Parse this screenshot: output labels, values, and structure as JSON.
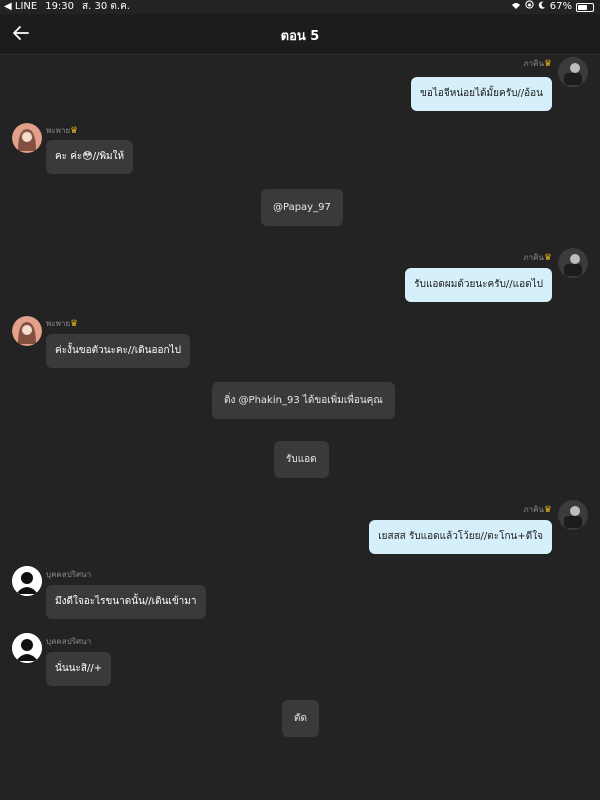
{
  "status_bar": {
    "carrier": "◀ LINE",
    "time": "19:30",
    "date": "ส. 30 ต.ค.",
    "battery": "67%"
  },
  "header": {
    "title": "ตอน 5",
    "back_icon": "arrow-left-icon"
  },
  "messages": [
    {
      "side": "right",
      "name": "ภาคิน",
      "text": "ขอไอจีหน่อยได้มั้ยครับ//อ้อน"
    },
    {
      "side": "left",
      "name": "พะพาย",
      "text": "คะ ค่ะ😳//พิมให้"
    },
    {
      "side": "system",
      "text": "@Papay_97"
    },
    {
      "side": "right",
      "name": "ภาคิน",
      "text": "รับแอดผมด้วยนะครับ//แอดไป"
    },
    {
      "side": "left",
      "name": "พะพาย",
      "text": "ค่ะงั้นขอตัวนะคะ//เดินออกไป"
    },
    {
      "side": "system",
      "text": "ติ่ง @Phakin_93 ได้ขอเพิ่มเพื่อนคุณ"
    },
    {
      "side": "system",
      "text": "รับแอด"
    },
    {
      "side": "right",
      "name": "ภาคิน",
      "text": "เยสสส รับแอดแล้วโว้ยย//ตะโกน+ดีใจ"
    },
    {
      "side": "left",
      "name": "บุคคลปริศนา",
      "text": "มึงดีใจอะไรขนาดนั้น//เดินเข้ามา"
    },
    {
      "side": "left",
      "name": "บุคคลปริศนา",
      "text": "นั่นนะสิ//+"
    },
    {
      "side": "system",
      "text": "ตัด"
    }
  ],
  "colors": {
    "background": "#232323",
    "bubble_right": "#d6f0fb",
    "bubble_left": "#3a3a3a",
    "crown": "#e9b41a"
  }
}
